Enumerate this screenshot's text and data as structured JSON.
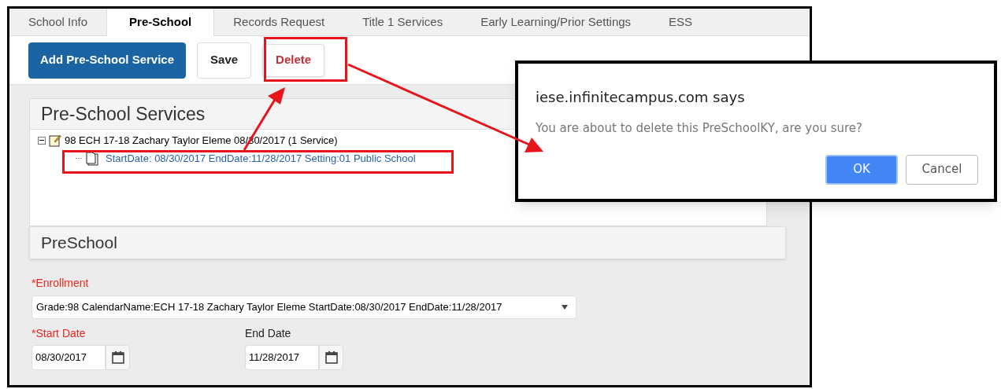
{
  "tabs": [
    {
      "label": "School Info",
      "selected": false
    },
    {
      "label": "Pre-School",
      "selected": true
    },
    {
      "label": "Records Request",
      "selected": false
    },
    {
      "label": "Title 1 Services",
      "selected": false
    },
    {
      "label": "Early Learning/Prior Settings",
      "selected": false
    },
    {
      "label": "ESS",
      "selected": false
    }
  ],
  "toolbar": [
    {
      "label": "Add Pre-School Service",
      "kind": "primary"
    },
    {
      "label": "Save",
      "kind": "plain"
    },
    {
      "label": "Delete",
      "kind": "danger"
    }
  ],
  "services_panel": {
    "title": "Pre-School Services",
    "tree": [
      {
        "label": "98 ECH 17-18 Zachary Taylor Eleme 08/30/2017 (1 Service)",
        "expanded": true,
        "children": [
          {
            "label": "StartDate: 08/30/2017 EndDate:11/28/2017 Setting:01 Public School"
          }
        ]
      }
    ]
  },
  "preschool_panel": {
    "title": "PreSchool"
  },
  "enrollment": {
    "label": "*Enrollment",
    "value": "Grade:98 CalendarName:ECH 17-18 Zachary Taylor Eleme StartDate:08/30/2017 EndDate:11/28/2017"
  },
  "date_fields": [
    {
      "label": "*Start Date",
      "required": true,
      "value": "08/30/2017"
    },
    {
      "label": "End Date",
      "required": false,
      "value": "11/28/2017"
    }
  ],
  "dialog": {
    "title": "iese.infinitecampus.com says",
    "message": "You are about to delete this PreSchoolKY, are you sure?",
    "buttons": [
      {
        "label": "OK",
        "kind": "primary"
      },
      {
        "label": "Cancel",
        "kind": "plain"
      }
    ]
  }
}
